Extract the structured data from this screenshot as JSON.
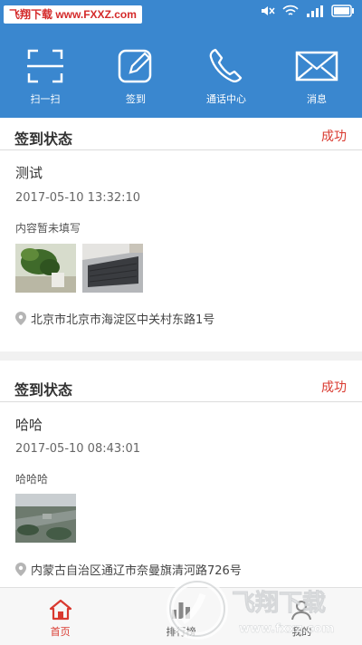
{
  "watermark_top": "飞翔下载 www.FXXZ.com",
  "toolbar": {
    "items": [
      {
        "label": "扫一扫",
        "icon": "scan-icon"
      },
      {
        "label": "签到",
        "icon": "edit-icon"
      },
      {
        "label": "通话中心",
        "icon": "phone-icon"
      },
      {
        "label": "消息",
        "icon": "mail-icon"
      }
    ]
  },
  "records": [
    {
      "header": "签到状态",
      "status": "成功",
      "name": "测试",
      "time": "2017-05-10 13:32:10",
      "note": "内容暂未填写",
      "address": "北京市北京市海淀区中关村东路1号"
    },
    {
      "header": "签到状态",
      "status": "成功",
      "name": "哈哈",
      "time": "2017-05-10 08:43:01",
      "note": "哈哈哈",
      "address": "内蒙古自治区通辽市奈曼旗清河路726号"
    }
  ],
  "tabbar": {
    "tabs": [
      {
        "label": "首页",
        "icon": "home-icon",
        "active": true
      },
      {
        "label": "排行榜",
        "icon": "ranking-icon",
        "active": false
      },
      {
        "label": "我的",
        "icon": "profile-icon",
        "active": false
      }
    ]
  },
  "watermark_bottom": {
    "brand": "飞翔下载",
    "url": "www.fxxz.com"
  },
  "colors": {
    "primary": "#3a87cf",
    "success": "#d9392f",
    "active_tab": "#d9392f"
  }
}
